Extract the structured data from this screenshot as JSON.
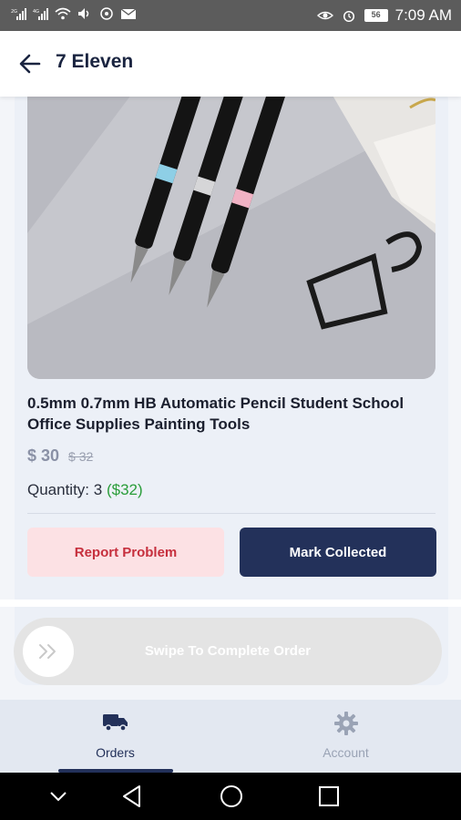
{
  "status_bar": {
    "time": "7:09 AM",
    "battery": "56"
  },
  "app_bar": {
    "title": "7 Eleven",
    "back_icon": "arrow-left-icon"
  },
  "product": {
    "title": "0.5mm 0.7mm HB Automatic Pencil Student School Office Supplies Painting Tools",
    "price": "$ 30",
    "old_price": "$ 32",
    "quantity_label": "Quantity: 3",
    "quantity_total": "($32)"
  },
  "actions": {
    "report_label": "Report Problem",
    "collect_label": "Mark Collected"
  },
  "swipe": {
    "label": "Swipe To Complete Order",
    "icon": "double-chevron-right-icon"
  },
  "bottom_nav": {
    "items": [
      {
        "label": "Orders",
        "icon": "truck-icon",
        "active": true
      },
      {
        "label": "Account",
        "icon": "gear-icon",
        "active": false
      }
    ]
  },
  "colors": {
    "primary": "#23315a",
    "danger": "#c62f3d",
    "success": "#2a9d3a"
  }
}
